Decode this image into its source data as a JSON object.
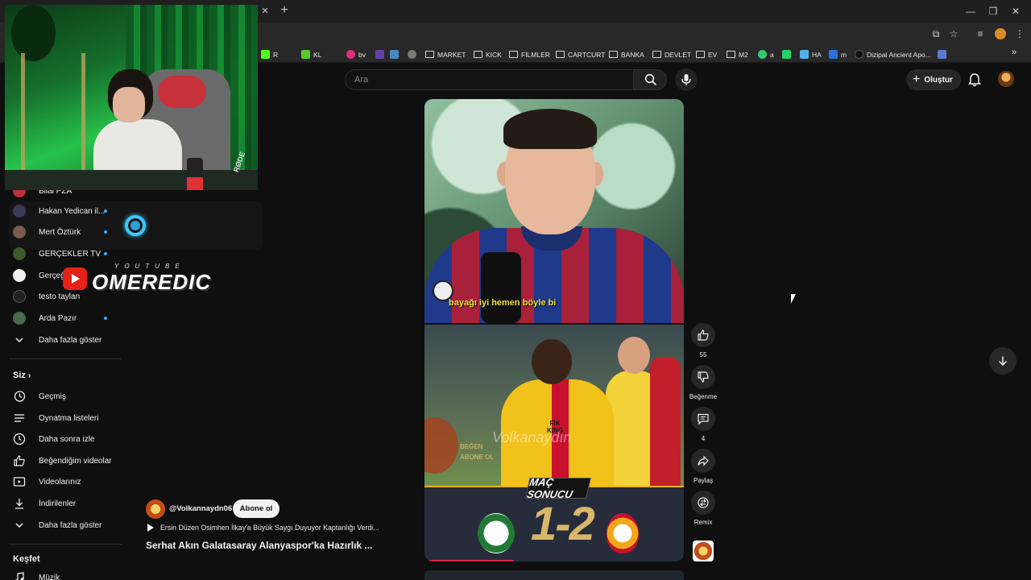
{
  "browser": {
    "bookmarks": [
      {
        "label": "R",
        "color": "#53fc18"
      },
      {
        "label": "KL",
        "color": "#5ac82e"
      },
      {
        "label": "bv",
        "color": "#e0307a"
      },
      {
        "label": "",
        "color": "#6441a5"
      },
      {
        "label": "",
        "color": "#4a86c5"
      },
      {
        "label": "",
        "color": "#9146ff"
      },
      {
        "label": "",
        "color": "#3b6ed8"
      },
      {
        "label": "",
        "color": "#1b2838"
      },
      {
        "label": "",
        "color": "#7a7a7a"
      }
    ],
    "folders": [
      "MARKET",
      "KICK",
      "FİLMLER",
      "CARTCURT",
      "BANKA",
      "DEVLET",
      "EV",
      "M2"
    ],
    "bookmarks_tail": [
      {
        "label": "a",
        "color": "#2ecc71"
      },
      {
        "label": "",
        "color": "#25d366"
      },
      {
        "label": "HA",
        "color": "#4fb3e8"
      },
      {
        "label": "m",
        "color": "#2b6fe0"
      },
      {
        "label": "Dizipal Ancient Apo...",
        "color": "#111111"
      },
      {
        "label": "",
        "color": "#5b7bd5"
      }
    ],
    "more_label": "»"
  },
  "header": {
    "search_placeholder": "Ara",
    "create_label": "Oluştur",
    "create_plus": "+"
  },
  "sidebar": {
    "subscriptions": [
      {
        "label": "Bilal PZA",
        "color": "#c0303a",
        "dot": false
      },
      {
        "label": "Hakan Yedican il...",
        "color": "#3a3a5a",
        "dot": true
      },
      {
        "label": "Mert Öztürk",
        "color": "#7a5a4a",
        "dot": true
      },
      {
        "label": "GERÇEKLER TV",
        "color": "#3b5a2a",
        "dot": true
      },
      {
        "label": "Gerçeği",
        "color": "#f1f1f1",
        "dot": false
      },
      {
        "label": "testo taylan",
        "color": "#222222",
        "dot": false
      },
      {
        "label": "Arda Pazır",
        "color": "#4a6a4a",
        "dot": true
      }
    ],
    "show_more": "Daha fazla göster",
    "you_header": "Siz",
    "you_items": [
      "Geçmiş",
      "Oynatma listeleri",
      "Daha sonra izle",
      "Beğendiğim videolar",
      "Videolarınız",
      "İndirilenler"
    ],
    "you_show_more": "Daha fazla göster",
    "explore_header": "Keşfet",
    "explore_items": [
      "Müzik"
    ]
  },
  "overlay": {
    "logo_sub": "YOUTUBE",
    "logo_main": "OMEREDIC",
    "webcam_text": "RØDE"
  },
  "short": {
    "subtitle": "bayağı iyi hemen böyle bi",
    "watermark": "Volkanaydın",
    "promo_lines": [
      "BEĞEN",
      "ABONE OL"
    ],
    "banner": "MAÇ SONUCU",
    "score": "1-2",
    "sponsor": "FİK KING",
    "progress": 0.34,
    "channel": "@Volkannaydn06",
    "subscribe_label": "Abone ol",
    "music": "Ersin Düzen Osimhen İlkay'a Büyük Saygı Duyuyor Kaptanlığı Verdi...",
    "title": "Serhat Akın Galatasaray Alanyaspor'ka Hazırlık ..."
  },
  "actions": {
    "like_count": "55",
    "dislike_label": "Beğenme",
    "comment_count": "4",
    "share_label": "Paylaş",
    "remix_label": "Remix"
  }
}
